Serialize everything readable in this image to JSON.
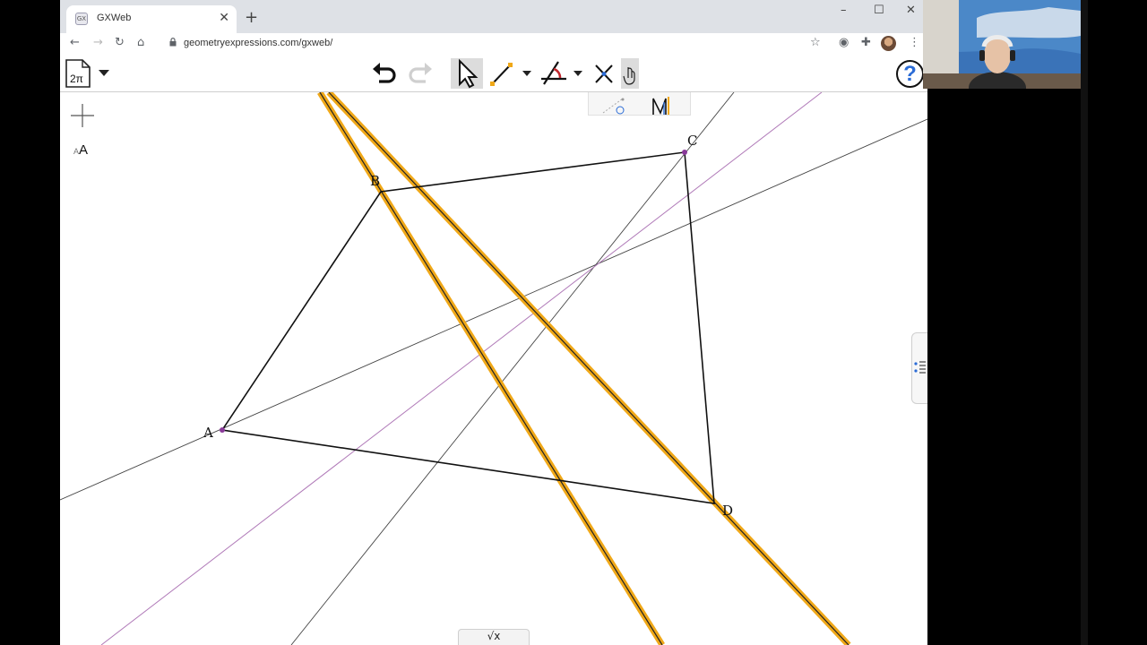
{
  "browser": {
    "tab_title": "GXWeb",
    "tab_favicon": "GX",
    "url": "geometryexpressions.com/gxweb/",
    "icons": [
      "back-arrow-icon",
      "forward-arrow-icon",
      "reload-icon",
      "home-icon",
      "lock-icon",
      "star-icon",
      "extension-icon",
      "puzzle-icon",
      "menu-dots-icon"
    ]
  },
  "toolbar": {
    "doc_label": "2π",
    "help_label": "?",
    "tools": [
      "undo-icon",
      "redo-icon",
      "select-arrow-icon",
      "segment-tool-icon",
      "angle-tool-icon",
      "intersection-tool-icon"
    ]
  },
  "canvas": {
    "text_size_small": "A",
    "text_size_big": "A",
    "points": [
      {
        "label": "A"
      },
      {
        "label": "B"
      },
      {
        "label": "C"
      },
      {
        "label": "D"
      }
    ],
    "formula_label": "√x"
  },
  "colors": {
    "highlight_line": "#f0a818",
    "bisector_purple": "#b07ab8",
    "point_purple": "#8a3a9a",
    "help_blue": "#2b6cd6"
  }
}
